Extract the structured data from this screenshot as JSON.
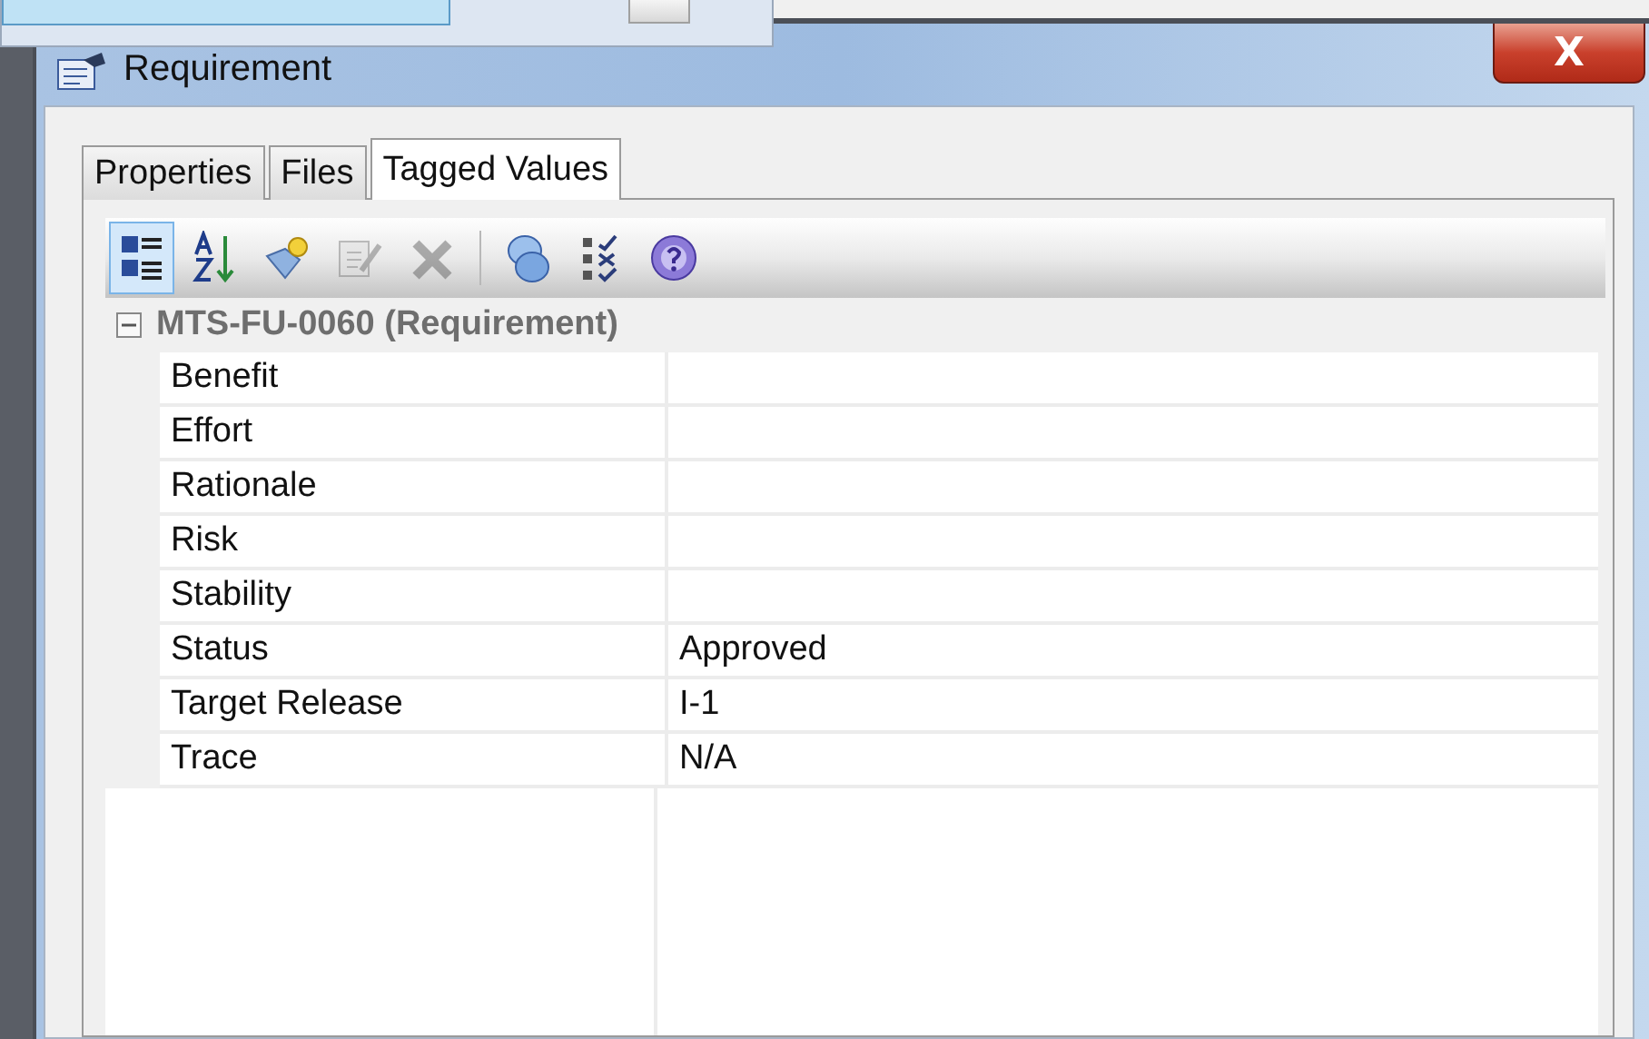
{
  "window": {
    "title": "Requirement",
    "close_label": "X"
  },
  "tabs": [
    {
      "label": "Properties",
      "selected": false
    },
    {
      "label": "Files",
      "selected": false
    },
    {
      "label": "Tagged Values",
      "selected": true
    }
  ],
  "toolbar": [
    {
      "kind": "categorized",
      "selected": true,
      "disabled": false
    },
    {
      "kind": "sort",
      "selected": false,
      "disabled": false
    },
    {
      "kind": "new",
      "selected": false,
      "disabled": false
    },
    {
      "kind": "edit",
      "selected": false,
      "disabled": true
    },
    {
      "kind": "delete",
      "selected": false,
      "disabled": true
    },
    {
      "kind": "separator"
    },
    {
      "kind": "tags",
      "selected": false,
      "disabled": false
    },
    {
      "kind": "checklist",
      "selected": false,
      "disabled": false
    },
    {
      "kind": "help",
      "selected": false,
      "disabled": false
    }
  ],
  "group": {
    "title": "MTS-FU-0060 (Requirement)",
    "expanded": true
  },
  "rows": [
    {
      "name": "Benefit"
    },
    {
      "name": "Effort"
    },
    {
      "name": "Rationale"
    },
    {
      "name": "Risk"
    },
    {
      "name": "Stability"
    },
    {
      "name": "Status",
      "value": "Approved"
    },
    {
      "name": "Target Release",
      "value": "I-1"
    },
    {
      "name": "Trace",
      "value": "N/A"
    }
  ]
}
